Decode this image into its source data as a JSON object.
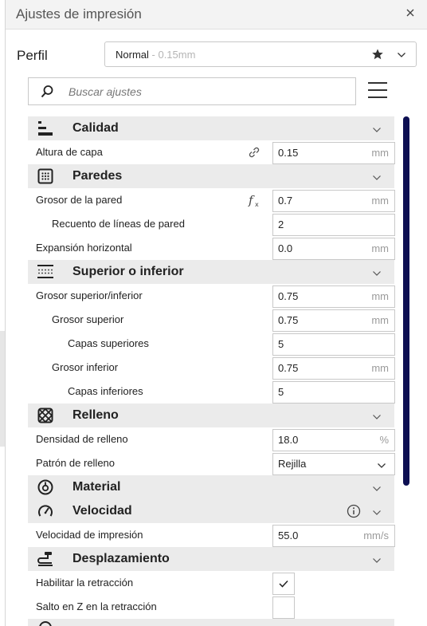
{
  "window": {
    "title": "Ajustes de impresión"
  },
  "profile": {
    "label": "Perfil",
    "name": "Normal",
    "sub": " - 0.15mm"
  },
  "search": {
    "placeholder": "Buscar ajustes"
  },
  "sections": {
    "calidad": {
      "title": "Calidad",
      "altura_capa": {
        "label": "Altura de capa",
        "value": "0.15",
        "unit": "mm"
      }
    },
    "paredes": {
      "title": "Paredes",
      "grosor_pared": {
        "label": "Grosor de la pared",
        "value": "0.7",
        "unit": "mm"
      },
      "recuento_lineas": {
        "label": "Recuento de líneas de pared",
        "value": "2"
      },
      "expansion": {
        "label": "Expansión horizontal",
        "value": "0.0",
        "unit": "mm"
      }
    },
    "superior": {
      "title": "Superior o inferior",
      "grosor_si": {
        "label": "Grosor superior/inferior",
        "value": "0.75",
        "unit": "mm"
      },
      "grosor_sup": {
        "label": "Grosor superior",
        "value": "0.75",
        "unit": "mm"
      },
      "capas_sup": {
        "label": "Capas superiores",
        "value": "5"
      },
      "grosor_inf": {
        "label": "Grosor inferior",
        "value": "0.75",
        "unit": "mm"
      },
      "capas_inf": {
        "label": "Capas inferiores",
        "value": "5"
      }
    },
    "relleno": {
      "title": "Relleno",
      "densidad": {
        "label": "Densidad de relleno",
        "value": "18.0",
        "unit": "%"
      },
      "patron": {
        "label": "Patrón de relleno",
        "value": "Rejilla"
      }
    },
    "material": {
      "title": "Material"
    },
    "velocidad": {
      "title": "Velocidad",
      "vel_impresion": {
        "label": "Velocidad de impresión",
        "value": "55.0",
        "unit": "mm/s"
      }
    },
    "desplazamiento": {
      "title": "Desplazamiento",
      "retraccion": {
        "label": "Habilitar la retracción",
        "checked": true
      },
      "salto_z": {
        "label": "Salto en Z en la retracción",
        "checked": false
      }
    }
  },
  "colors": {
    "accent": "#0d0f52",
    "category_bg": "#ebebeb"
  }
}
